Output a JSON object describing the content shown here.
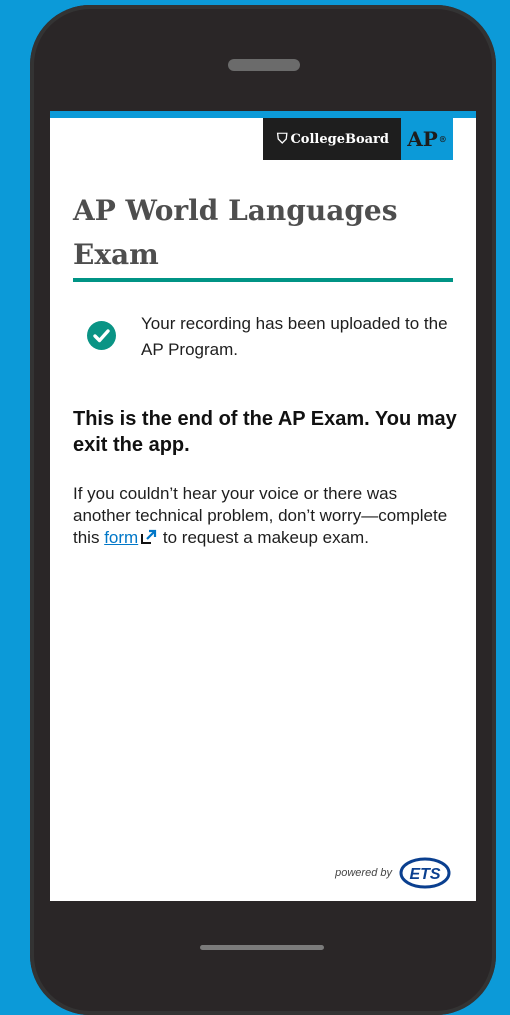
{
  "header": {
    "brand_name": "CollegeBoard",
    "ap_logo": "AP"
  },
  "page": {
    "title": "AP World Languages Exam"
  },
  "status": {
    "icon": "check-circle-icon",
    "message": "Your recording has been uploaded to the AP Program."
  },
  "end_message": "This is the end of the AP Exam. You may exit the app.",
  "help": {
    "before": "If you couldn’t hear your voice or there was another technical problem, don’t worry—complete this ",
    "link_label": "form",
    "after": " to request a makeup exam."
  },
  "footer": {
    "powered_by": "powered by",
    "partner_logo": "ETS"
  },
  "colors": {
    "background": "#0c9ad8",
    "accent_teal": "#009485",
    "link": "#0077c8",
    "title_text": "#4e4e4e"
  }
}
